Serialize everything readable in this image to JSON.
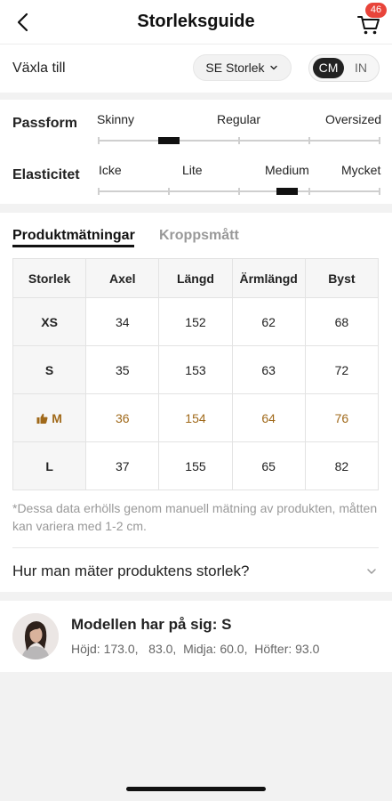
{
  "header": {
    "title": "Storleksguide",
    "cart_count": "46",
    "icons": {
      "back": "chevron-left-icon",
      "cart": "shopping-cart-icon"
    }
  },
  "switch": {
    "label": "Växla till",
    "size_system": "SE Storlek",
    "units": [
      "CM",
      "IN"
    ],
    "selected_unit": "CM"
  },
  "fit": {
    "passform": {
      "label": "Passform",
      "ticks": [
        "Skinny",
        "Regular",
        "Oversized"
      ],
      "value": 0.25
    },
    "elasticitet": {
      "label": "Elasticitet",
      "ticks": [
        "Icke",
        "Lite",
        "Medium",
        "Mycket"
      ],
      "value": 0.67
    }
  },
  "tabs": [
    "Produktmätningar",
    "Kroppsmått"
  ],
  "active_tab": "Produktmätningar",
  "table": {
    "headers": [
      "Storlek",
      "Axel",
      "Längd",
      "Ärmlängd",
      "Byst"
    ],
    "rows": [
      [
        "XS",
        "34",
        "152",
        "62",
        "68"
      ],
      [
        "S",
        "35",
        "153",
        "63",
        "72"
      ],
      [
        "M",
        "36",
        "154",
        "64",
        "76"
      ],
      [
        "L",
        "37",
        "155",
        "65",
        "82"
      ]
    ],
    "recommended_row": "M",
    "recommended_color": "#a0691a"
  },
  "note": "*Dessa data erhölls genom manuell mätning av produkten, måtten kan variera med 1-2 cm.",
  "howto": "Hur man mäter produktens storlek?",
  "model": {
    "title": "Modellen har på sig: S",
    "stats": "Höjd: 173.0,   83.0,  Midja: 60.0,  Höfter: 93.0"
  }
}
